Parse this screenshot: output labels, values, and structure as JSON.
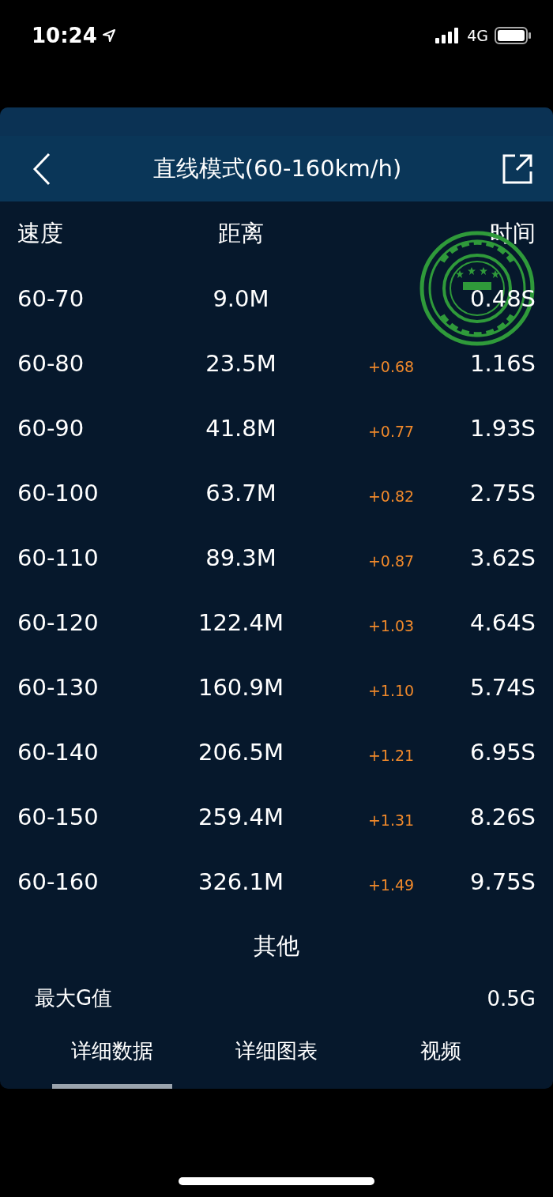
{
  "status_bar": {
    "time": "10:24",
    "network": "4G"
  },
  "header": {
    "title": "直线模式(60-160km/h)"
  },
  "table": {
    "columns": [
      "速度",
      "距离",
      "时间"
    ],
    "rows": [
      {
        "speed": "60-70",
        "distance": "9.0M",
        "time": "0.48S"
      },
      {
        "speed": "60-80",
        "distance": "23.5M",
        "delta": "+0.68",
        "time": "1.16S"
      },
      {
        "speed": "60-90",
        "distance": "41.8M",
        "delta": "+0.77",
        "time": "1.93S"
      },
      {
        "speed": "60-100",
        "distance": "63.7M",
        "delta": "+0.82",
        "time": "2.75S"
      },
      {
        "speed": "60-110",
        "distance": "89.3M",
        "delta": "+0.87",
        "time": "3.62S"
      },
      {
        "speed": "60-120",
        "distance": "122.4M",
        "delta": "+1.03",
        "time": "4.64S"
      },
      {
        "speed": "60-130",
        "distance": "160.9M",
        "delta": "+1.10",
        "time": "5.74S"
      },
      {
        "speed": "60-140",
        "distance": "206.5M",
        "delta": "+1.21",
        "time": "6.95S"
      },
      {
        "speed": "60-150",
        "distance": "259.4M",
        "delta": "+1.31",
        "time": "8.26S"
      },
      {
        "speed": "60-160",
        "distance": "326.1M",
        "delta": "+1.49",
        "time": "9.75S"
      }
    ]
  },
  "other": {
    "title": "其他",
    "items": [
      {
        "label": "最大G值",
        "value": "0.5G"
      }
    ]
  },
  "tabs": [
    {
      "label": "详细数据",
      "selected": true
    },
    {
      "label": "详细图表",
      "selected": false
    },
    {
      "label": "视频",
      "selected": false
    }
  ]
}
